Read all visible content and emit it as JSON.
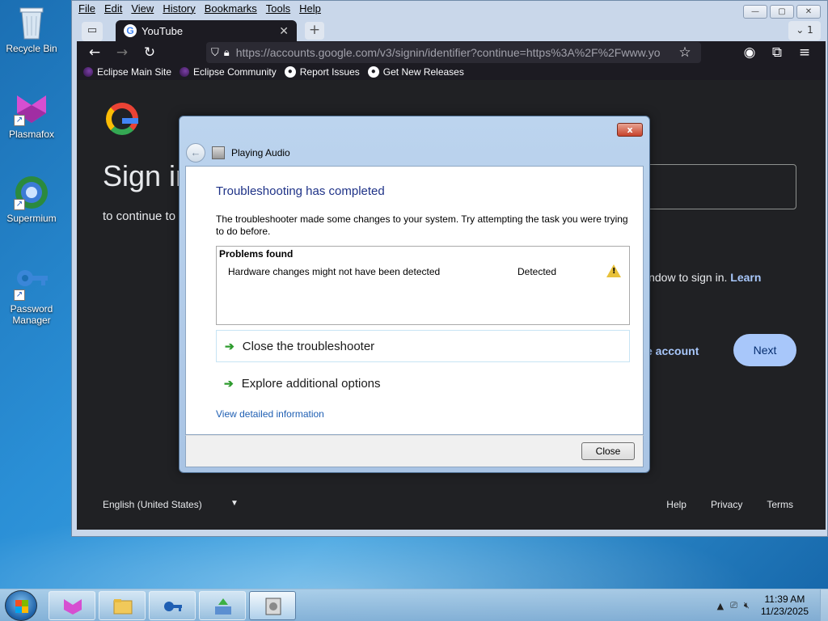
{
  "desktop": {
    "icons": [
      {
        "label": "Recycle Bin"
      },
      {
        "label": "Plasmafox"
      },
      {
        "label": "Supermium"
      },
      {
        "label": "Password Manager"
      }
    ]
  },
  "browser": {
    "menu": [
      "File",
      "Edit",
      "View",
      "History",
      "Bookmarks",
      "Tools",
      "Help"
    ],
    "tab_title": "YouTube",
    "tab_count": "1",
    "url_host": "https://accounts.google.com",
    "url_path": "/v3/signin/identifier?continue=https%3A%2F%2Fwww.yo",
    "bookmarks": [
      "Eclipse Main Site",
      "Eclipse Community",
      "Report Issues",
      "Get New Releases"
    ]
  },
  "google_page": {
    "heading": "Sign in",
    "subheading": "to continue to",
    "learn_text": "indow to sign in.",
    "learn_link": "Learn",
    "create_account": "e account",
    "next_label": "Next",
    "language": "English (United States)",
    "footer_links": [
      "Help",
      "Privacy",
      "Terms"
    ]
  },
  "dialog": {
    "window_title": "Playing Audio",
    "close_x": "x",
    "title": "Troubleshooting has completed",
    "description": "The troubleshooter made some changes to your system. Try attempting the task you were trying to do before.",
    "problems_header": "Problems found",
    "problem": {
      "description": "Hardware changes might not have been detected",
      "status": "Detected"
    },
    "options": [
      "Close the troubleshooter",
      "Explore additional options"
    ],
    "detail_link": "View detailed information",
    "close_button": "Close"
  },
  "taskbar": {
    "time": "11:39 AM",
    "date": "11/23/2025"
  }
}
